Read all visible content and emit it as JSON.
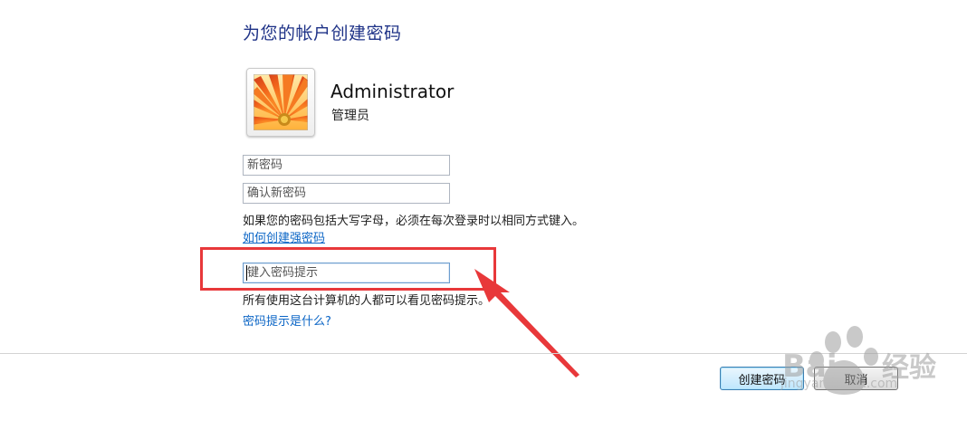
{
  "page": {
    "title": "为您的帐户创建密码"
  },
  "account": {
    "name": "Administrator",
    "role": "管理员",
    "avatar_icon": "flower-avatar-icon"
  },
  "form": {
    "new_password_placeholder": "新密码",
    "confirm_password_placeholder": "确认新密码",
    "case_note": "如果您的密码包括大写字母，必须在每次登录时以相同方式键入。",
    "strong_password_link": "如何创建强密码",
    "hint_placeholder": "键入密码提示",
    "hint_visibility_note": "所有使用这台计算机的人都可以看见密码提示。",
    "hint_help_link": "密码提示是什么?"
  },
  "buttons": {
    "create": "创建密码",
    "cancel": "取消"
  },
  "annotation": {
    "highlight_color": "#e8383a",
    "arrow_color": "#e8383a"
  },
  "watermark": {
    "brand": "Baidu经验",
    "url": "jingyan.baidu.com"
  }
}
